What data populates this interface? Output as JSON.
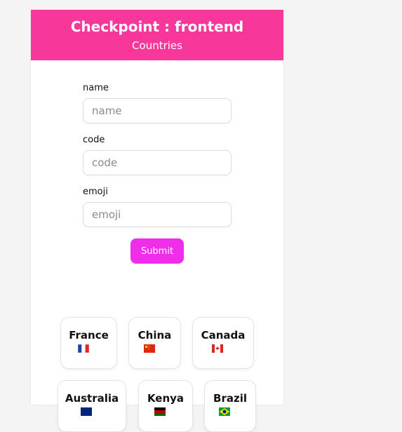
{
  "header": {
    "title": "Checkpoint : frontend",
    "subtitle": "Countries"
  },
  "form": {
    "name_label": "name",
    "name_placeholder": "name",
    "code_label": "code",
    "code_placeholder": "code",
    "emoji_label": "emoji",
    "emoji_placeholder": "emoji",
    "submit_label": "Submit"
  },
  "countries": [
    {
      "name": "France",
      "flag_icon": "france-flag-icon"
    },
    {
      "name": "China",
      "flag_icon": "china-flag-icon"
    },
    {
      "name": "Canada",
      "flag_icon": "canada-flag-icon"
    },
    {
      "name": "Australia",
      "flag_icon": "australia-flag-icon"
    },
    {
      "name": "Kenya",
      "flag_icon": "kenya-flag-icon"
    },
    {
      "name": "Brazil",
      "flag_icon": "brazil-flag-icon"
    }
  ],
  "colors": {
    "header_bg": "#f7379a",
    "submit_bg": "#f02ee9",
    "page_bg": "#f4f4f4"
  }
}
